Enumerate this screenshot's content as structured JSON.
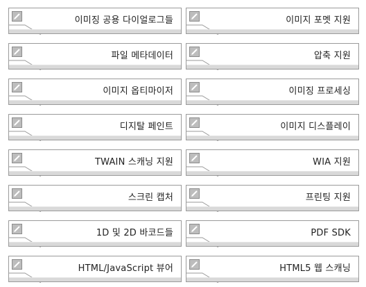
{
  "features": [
    {
      "left_label": "이미징 공용 다이얼로그들",
      "right_label": "이미지 포멧 지원"
    },
    {
      "left_label": "파일 메타데이터",
      "right_label": "압축 지원"
    },
    {
      "left_label": "이미지 옵티마이저",
      "right_label": "이미징 프로세싱"
    },
    {
      "left_label": "디지탈 페인트",
      "right_label": "이미지 디스플레이"
    },
    {
      "left_label": "TWAIN 스캐닝 지원",
      "right_label": "WIA 지원"
    },
    {
      "left_label": "스크린 캡처",
      "right_label": "프린팅 지원"
    },
    {
      "left_label": "1D 및 2D 바코드들",
      "right_label": "PDF SDK"
    },
    {
      "left_label": "HTML/JavaScript 뷰어",
      "right_label": "HTML5 웹 스캐닝"
    }
  ],
  "icon": "edit-pencil-icon"
}
